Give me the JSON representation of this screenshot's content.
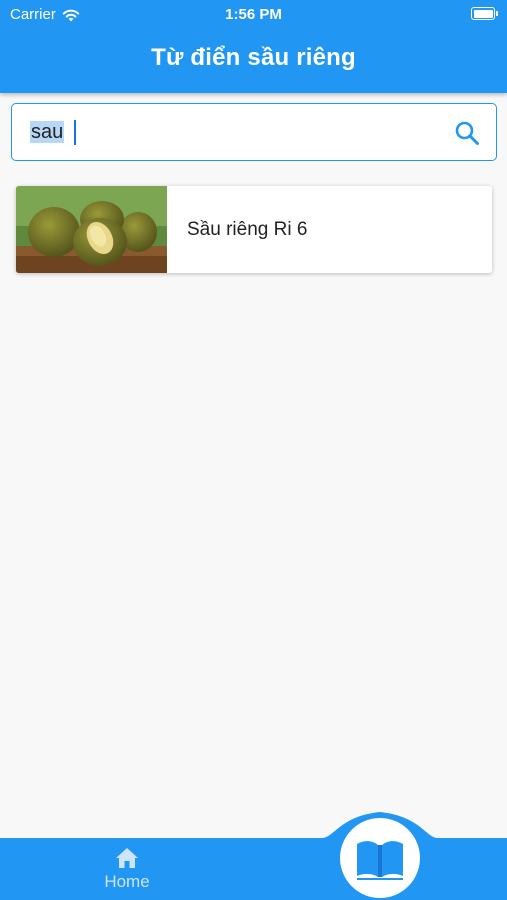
{
  "status_bar": {
    "carrier": "Carrier",
    "time": "1:56 PM"
  },
  "header": {
    "title": "Từ điển sầu riêng"
  },
  "search": {
    "value": "sau",
    "icon": "search-icon"
  },
  "results": [
    {
      "label": "Sầu riêng Ri 6",
      "thumbnail": "durian-photo"
    }
  ],
  "bottom_nav": {
    "home_label": "Home",
    "home_icon": "home-icon",
    "center_icon": "open-book-icon"
  },
  "colors": {
    "primary": "#2196f3",
    "background": "#f8f8f8",
    "selection": "#b7d7f6"
  }
}
